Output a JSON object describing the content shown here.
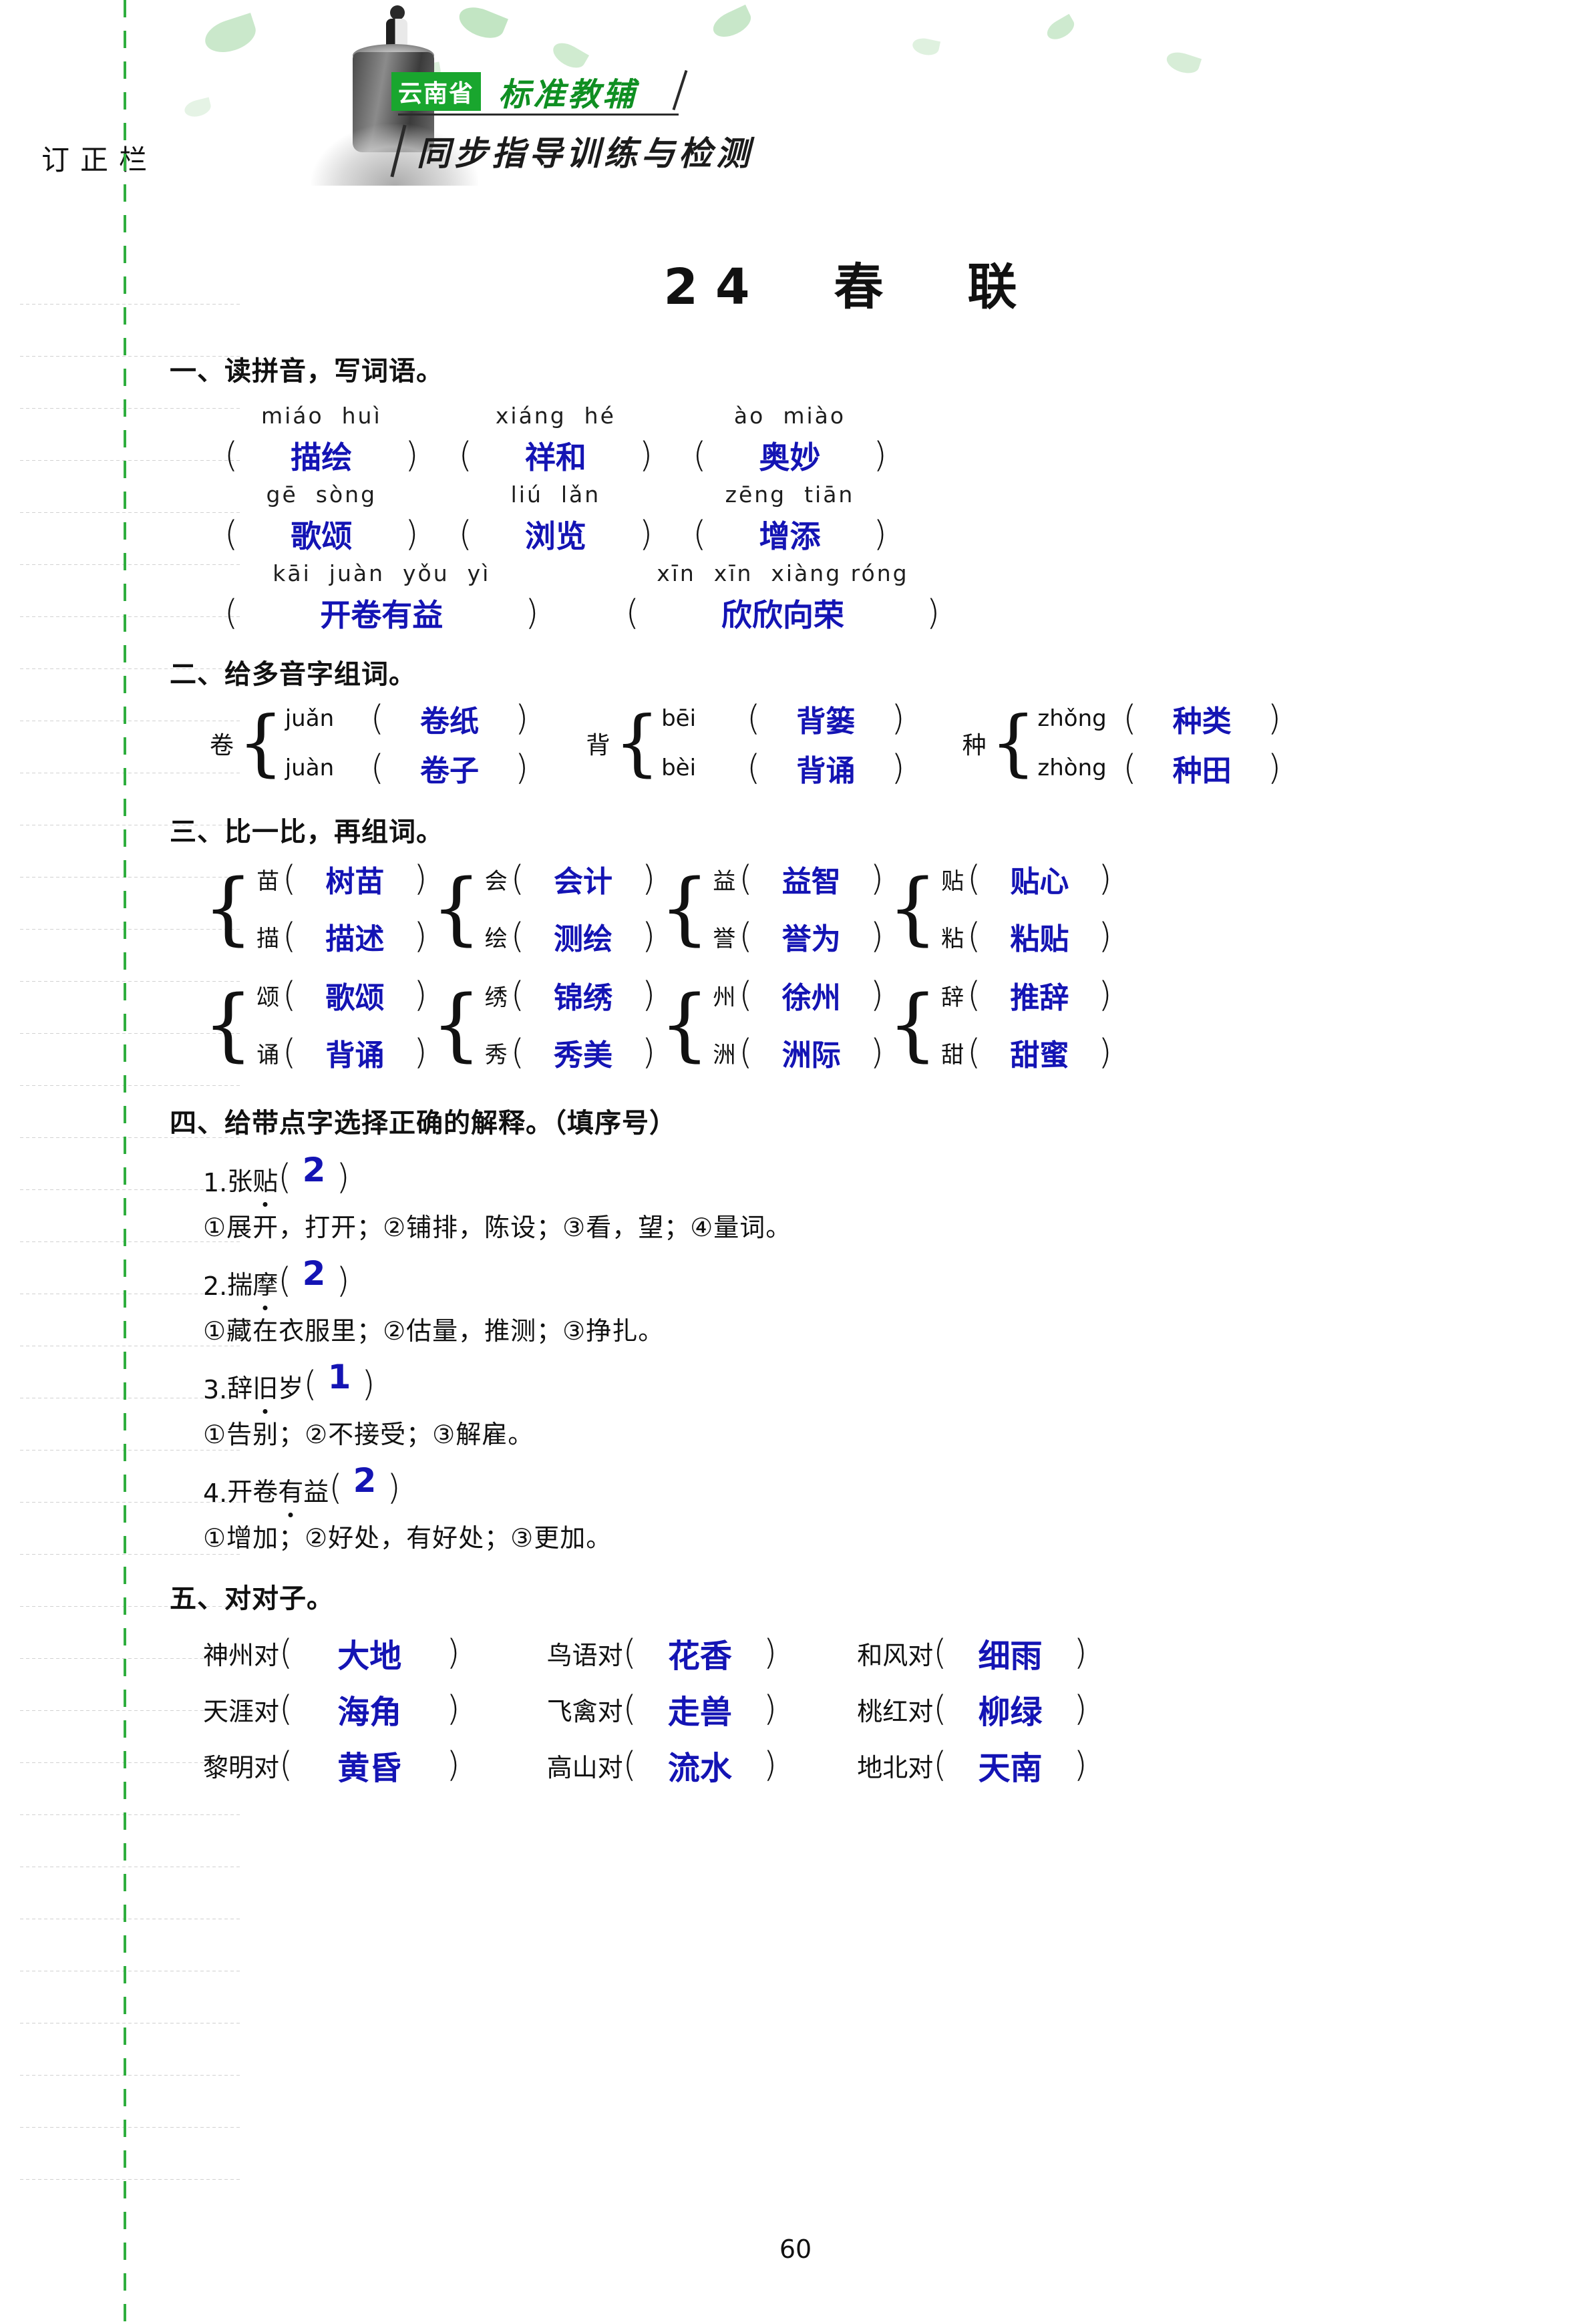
{
  "header": {
    "badge": "云南省",
    "brand": "标准教辅",
    "subtitle": "同步指导训练与检测"
  },
  "sidebar": {
    "title": "订正栏"
  },
  "page": {
    "number": "60",
    "title": "24　春　联"
  },
  "sections": {
    "s1": {
      "heading": "一、读拼音，写词语。",
      "rows": [
        [
          {
            "pinyin": "miáo  huì",
            "answer": "描绘"
          },
          {
            "pinyin": "xiáng  hé",
            "answer": "祥和"
          },
          {
            "pinyin": "ào  miào",
            "answer": "奥妙"
          }
        ],
        [
          {
            "pinyin": "gē  sòng",
            "answer": "歌颂"
          },
          {
            "pinyin": "liú  lǎn",
            "answer": "浏览"
          },
          {
            "pinyin": "zēng  tiān",
            "answer": "增添"
          }
        ],
        [
          {
            "pinyin": "kāi  juàn  yǒu  yì",
            "answer": "开卷有益"
          },
          {
            "pinyin": "xīn  xīn  xiàng róng",
            "answer": "欣欣向荣"
          }
        ]
      ]
    },
    "s2": {
      "heading": "二、给多音字组词。",
      "groups": [
        {
          "char": "卷",
          "items": [
            {
              "pinyin": "juǎn",
              "answer": "卷纸"
            },
            {
              "pinyin": "juàn",
              "answer": "卷子"
            }
          ]
        },
        {
          "char": "背",
          "items": [
            {
              "pinyin": "bēi",
              "answer": "背篓"
            },
            {
              "pinyin": "bèi",
              "answer": "背诵"
            }
          ]
        },
        {
          "char": "种",
          "items": [
            {
              "pinyin": "zhǒng",
              "answer": "种类"
            },
            {
              "pinyin": "zhòng",
              "answer": "种田"
            }
          ]
        }
      ]
    },
    "s3": {
      "heading": "三、比一比，再组词。",
      "rows": [
        [
          {
            "top": {
              "char": "苗",
              "answer": "树苗"
            },
            "bottom": {
              "char": "描",
              "answer": "描述"
            }
          },
          {
            "top": {
              "char": "会",
              "answer": "会计"
            },
            "bottom": {
              "char": "绘",
              "answer": "测绘"
            }
          },
          {
            "top": {
              "char": "益",
              "answer": "益智"
            },
            "bottom": {
              "char": "誉",
              "answer": "誉为"
            }
          },
          {
            "top": {
              "char": "贴",
              "answer": "贴心"
            },
            "bottom": {
              "char": "粘",
              "answer": "粘贴"
            }
          }
        ],
        [
          {
            "top": {
              "char": "颂",
              "answer": "歌颂"
            },
            "bottom": {
              "char": "诵",
              "answer": "背诵"
            }
          },
          {
            "top": {
              "char": "绣",
              "answer": "锦绣"
            },
            "bottom": {
              "char": "秀",
              "answer": "秀美"
            }
          },
          {
            "top": {
              "char": "州",
              "answer": "徐州"
            },
            "bottom": {
              "char": "洲",
              "answer": "洲际"
            }
          },
          {
            "top": {
              "char": "辞",
              "answer": "推辞"
            },
            "bottom": {
              "char": "甜",
              "answer": "甜蜜"
            }
          }
        ]
      ]
    },
    "s4": {
      "heading": "四、给带点字选择正确的解释。（填序号）",
      "items": [
        {
          "num": "1.",
          "word_pre": "张",
          "word_dot": "贴",
          "word_post": "",
          "answer": "2",
          "options": "①展开，打开；②铺排，陈设；③看，望；④量词。"
        },
        {
          "num": "2.",
          "word_pre": "揣",
          "word_dot": "摩",
          "word_post": "",
          "answer": "2",
          "options": "①藏在衣服里；②估量，推测；③挣扎。"
        },
        {
          "num": "3.",
          "word_pre": "辞",
          "word_dot": "旧",
          "word_post": "岁",
          "answer": "1",
          "options": "①告别；②不接受；③解雇。"
        },
        {
          "num": "4.",
          "word_pre": "开卷",
          "word_dot": "有",
          "word_post": "益",
          "answer": "2",
          "options": "①增加；②好处，有好处；③更加。"
        }
      ]
    },
    "s5": {
      "heading": "五、对对子。",
      "rows": [
        [
          {
            "lead": "神州对",
            "answer": "大地"
          },
          {
            "lead": "鸟语对",
            "answer": "花香"
          },
          {
            "lead": "和风对",
            "answer": "细雨"
          }
        ],
        [
          {
            "lead": "天涯对",
            "answer": "海角"
          },
          {
            "lead": "飞禽对",
            "answer": "走兽"
          },
          {
            "lead": "桃红对",
            "answer": "柳绿"
          }
        ],
        [
          {
            "lead": "黎明对",
            "answer": "黄昏"
          },
          {
            "lead": "高山对",
            "answer": "流水"
          },
          {
            "lead": "地北对",
            "answer": "天南"
          }
        ]
      ]
    }
  },
  "colors": {
    "answer_ink": "#1414b4",
    "brand_green": "#19a62e",
    "spine_green": "#2fae3e"
  }
}
